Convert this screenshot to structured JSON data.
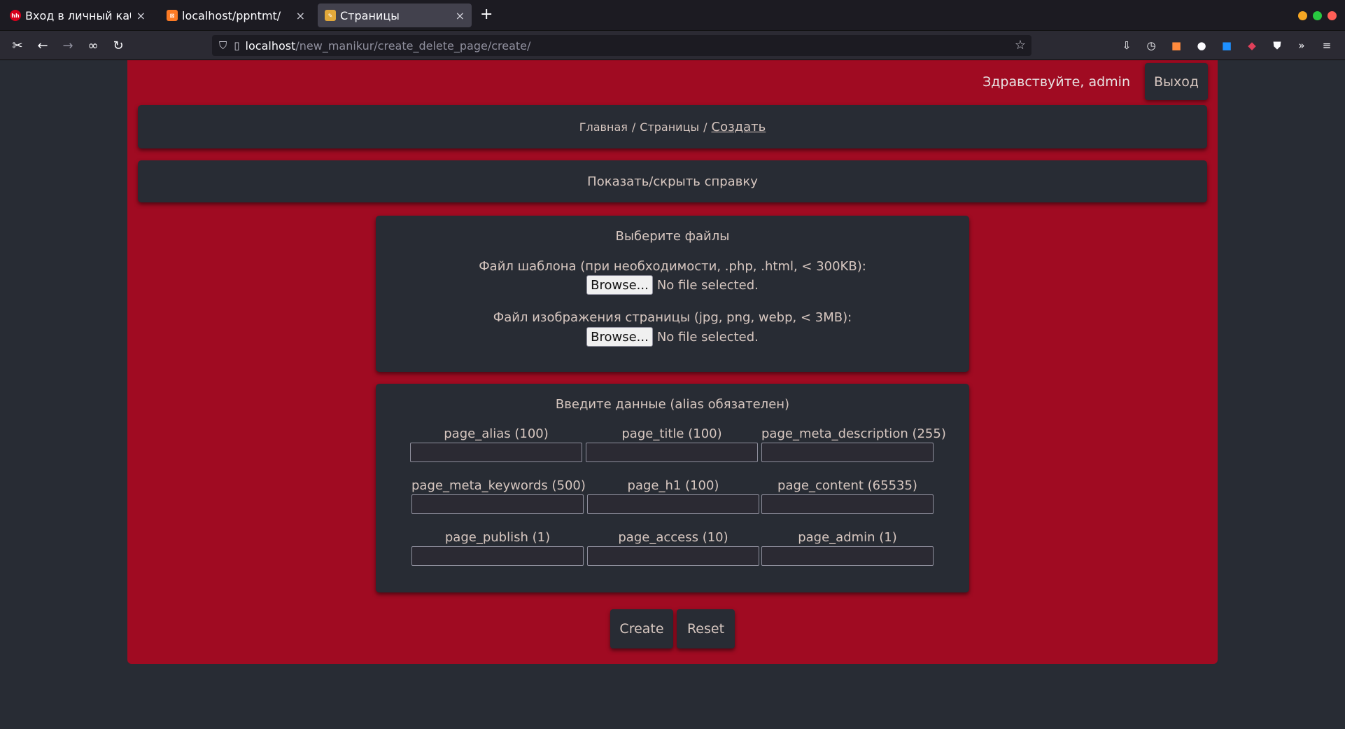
{
  "browser": {
    "tabs": [
      {
        "title": "Вход в личный кабинет",
        "favicon": "hh-icon",
        "active": false
      },
      {
        "title": "localhost/ppntmt/",
        "favicon": "xampp-icon",
        "active": false
      },
      {
        "title": "Страницы",
        "favicon": "page-icon",
        "active": true
      }
    ],
    "url_host": "localhost",
    "url_path": "/new_manikur/create_delete_page/create/"
  },
  "header": {
    "greeting": "Здравствуйте, admin",
    "logout_label": "Выход"
  },
  "breadcrumb": {
    "home": "Главная",
    "pages": "Страницы",
    "current": "Создать",
    "separator": "/"
  },
  "help_toggle": "Показать/скрыть справку",
  "files_panel": {
    "heading": "Выберите файлы",
    "template_label": "Файл шаблона (при необходимости, .php, .html, < 300KB):",
    "image_label": "Файл изображения страницы (jpg, png, webp, < 3MB):",
    "browse_label": "Browse...",
    "no_file": "No file selected."
  },
  "data_panel": {
    "heading": "Введите данные (alias обязателен)",
    "fields": [
      "page_alias (100)",
      "page_title (100)",
      "page_meta_description (255)",
      "page_meta_keywords (500)",
      "page_h1 (100)",
      "page_content (65535)",
      "page_publish (1)",
      "page_access (10)",
      "page_admin (1)"
    ]
  },
  "actions": {
    "create_label": "Create",
    "reset_label": "Reset"
  },
  "colors": {
    "accent": "#a00b22",
    "panel": "#282c34",
    "text": "#d7c7c0"
  }
}
